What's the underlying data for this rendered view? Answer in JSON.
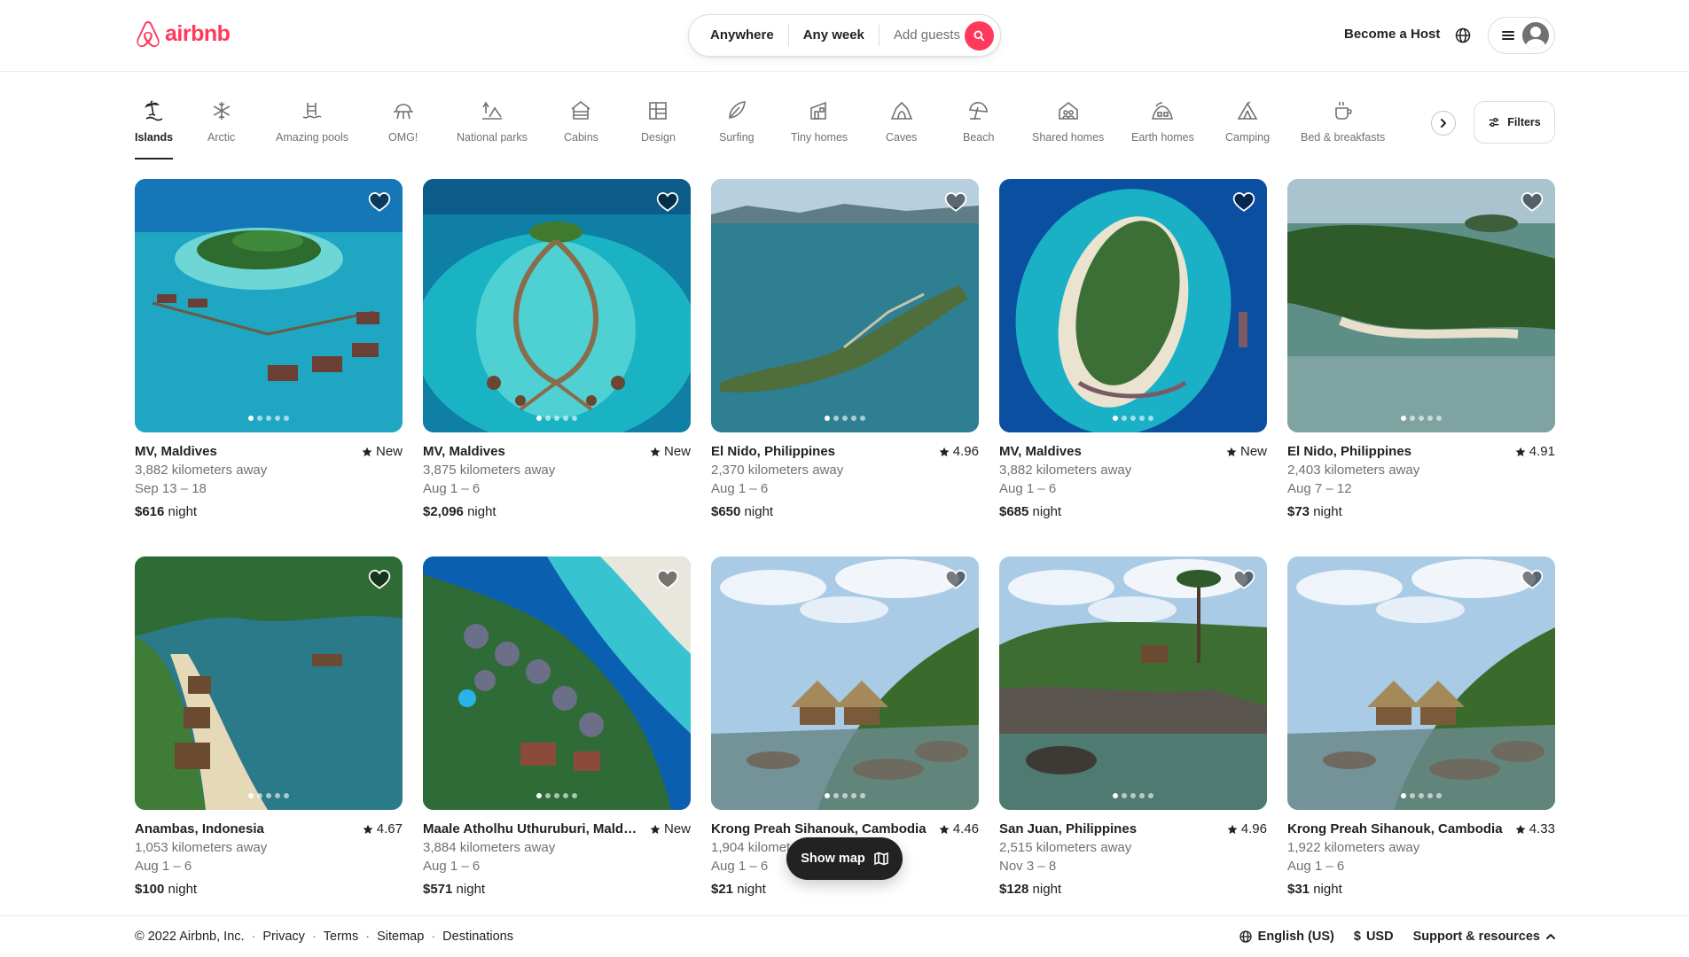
{
  "brand": {
    "name": "airbnb",
    "color": "#FF385C"
  },
  "search": {
    "location": "Anywhere",
    "dates": "Any week",
    "guests": "Add guests"
  },
  "header": {
    "host_link": "Become a Host"
  },
  "categories": [
    {
      "label": "Islands",
      "icon": "island-icon",
      "active": true
    },
    {
      "label": "Arctic",
      "icon": "snowflake-icon"
    },
    {
      "label": "Amazing pools",
      "icon": "pool-icon"
    },
    {
      "label": "OMG!",
      "icon": "ufo-house-icon"
    },
    {
      "label": "National parks",
      "icon": "park-icon"
    },
    {
      "label": "Cabins",
      "icon": "cabin-icon"
    },
    {
      "label": "Design",
      "icon": "design-building-icon"
    },
    {
      "label": "Surfing",
      "icon": "surfboard-icon"
    },
    {
      "label": "Tiny homes",
      "icon": "tiny-home-icon"
    },
    {
      "label": "Caves",
      "icon": "cave-icon"
    },
    {
      "label": "Beach",
      "icon": "beach-umbrella-icon"
    },
    {
      "label": "Shared homes",
      "icon": "shared-home-icon"
    },
    {
      "label": "Earth homes",
      "icon": "earth-home-icon"
    },
    {
      "label": "Camping",
      "icon": "tent-icon"
    },
    {
      "label": "Bed & breakfasts",
      "icon": "breakfast-icon"
    }
  ],
  "filters_label": "Filters",
  "listings": [
    {
      "location": "MV, Maldives",
      "rating": "New",
      "distance": "3,882 kilometers away",
      "dates": "Sep 13 – 18",
      "price": "$616",
      "unit": "night",
      "scene": "maldives-villas"
    },
    {
      "location": "MV, Maldives",
      "rating": "New",
      "distance": "3,875 kilometers away",
      "dates": "Aug 1 – 6",
      "price": "$2,096",
      "unit": "night",
      "scene": "maldives-ring"
    },
    {
      "location": "El Nido, Philippines",
      "rating": "4.96",
      "distance": "2,370 kilometers away",
      "dates": "Aug 1 – 6",
      "price": "$650",
      "unit": "night",
      "scene": "elnido-island"
    },
    {
      "location": "MV, Maldives",
      "rating": "New",
      "distance": "3,882 kilometers away",
      "dates": "Aug 1 – 6",
      "price": "$685",
      "unit": "night",
      "scene": "maldives-atoll"
    },
    {
      "location": "El Nido, Philippines",
      "rating": "4.91",
      "distance": "2,403 kilometers away",
      "dates": "Aug 7 – 12",
      "price": "$73",
      "unit": "night",
      "scene": "elnido-jungle"
    },
    {
      "location": "Anambas, Indonesia",
      "rating": "4.67",
      "distance": "1,053 kilometers away",
      "dates": "Aug 1 – 6",
      "price": "$100",
      "unit": "night",
      "scene": "anambas-bay"
    },
    {
      "location": "Maale Atholhu Uthuruburi, Maldiv...",
      "rating": "New",
      "distance": "3,884 kilometers away",
      "dates": "Aug 1 – 6",
      "price": "$571",
      "unit": "night",
      "scene": "maldives-resort"
    },
    {
      "location": "Krong Preah Sihanouk, Cambodia",
      "rating": "4.46",
      "distance": "1,904 kilometers away",
      "dates": "Aug 1 – 6",
      "price": "$21",
      "unit": "night",
      "scene": "cambodia-huts"
    },
    {
      "location": "San Juan, Philippines",
      "rating": "4.96",
      "distance": "2,515 kilometers away",
      "dates": "Nov 3 – 8",
      "price": "$128",
      "unit": "night",
      "scene": "sanjuan-rocks"
    },
    {
      "location": "Krong Preah Sihanouk, Cambodia",
      "rating": "4.33",
      "distance": "1,922 kilometers away",
      "dates": "Aug 1 – 6",
      "price": "$31",
      "unit": "night",
      "scene": "cambodia-huts"
    }
  ],
  "show_map": "Show map",
  "footer": {
    "copyright": "© 2022 Airbnb, Inc.",
    "links": [
      "Privacy",
      "Terms",
      "Sitemap",
      "Destinations"
    ],
    "language": "English (US)",
    "currency_symbol": "$",
    "currency": "USD",
    "support": "Support & resources"
  }
}
